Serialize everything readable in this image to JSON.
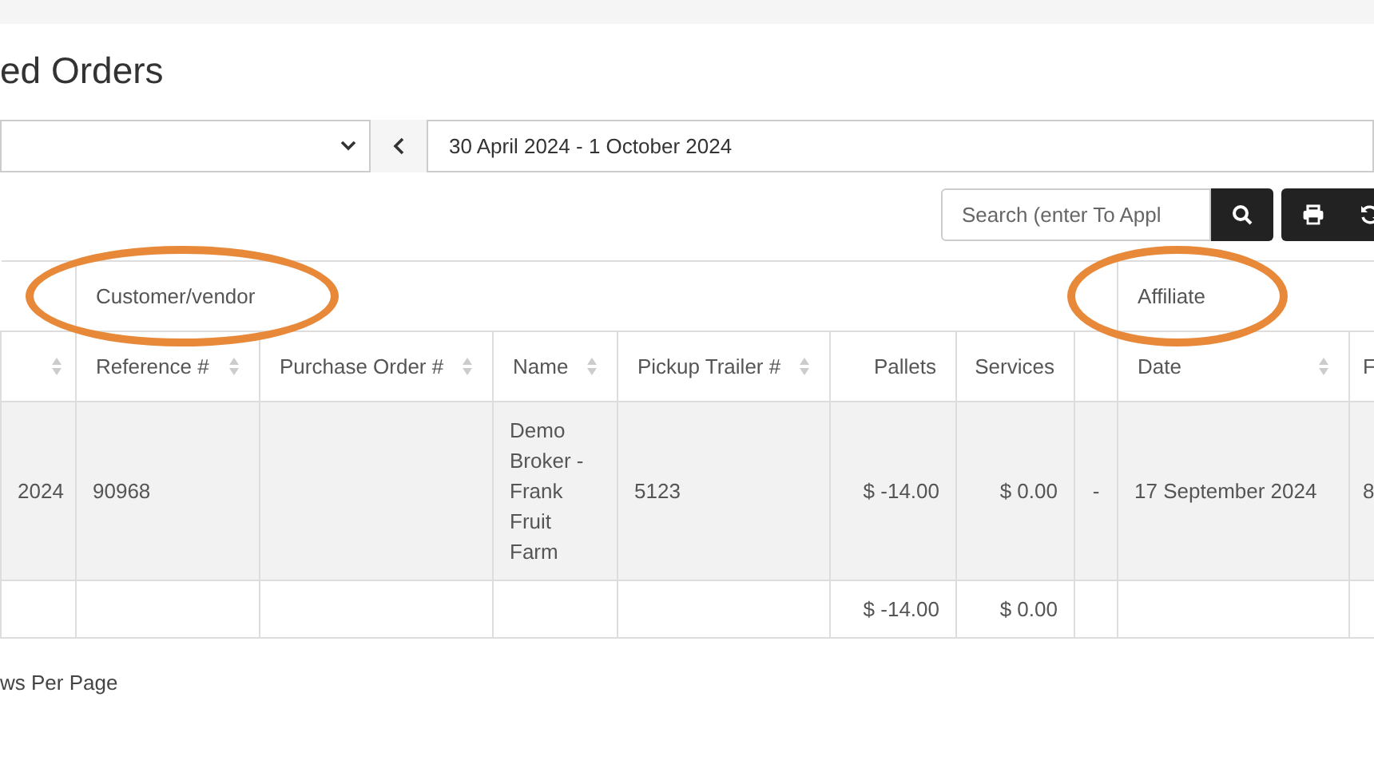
{
  "title": "ed Orders",
  "date_range": "30 April 2024 - 1 October 2024",
  "search": {
    "placeholder": "Search (enter To Appl"
  },
  "table": {
    "column_groups": [
      {
        "label": "Customer/vendor",
        "circled": true
      },
      {
        "label": "Affiliate",
        "circled": true
      }
    ],
    "columns": [
      {
        "sortable": true
      },
      {
        "label": "Reference #",
        "sortable": true
      },
      {
        "label": "Purchase Order #",
        "sortable": true
      },
      {
        "label": "Name",
        "sortable": true
      },
      {
        "label": "Pickup Trailer #",
        "sortable": true
      },
      {
        "label": "Pallets",
        "sortable": false
      },
      {
        "label": "Services",
        "sortable": false
      },
      {},
      {
        "label": "Date",
        "sortable": true
      },
      {
        "label": "F",
        "sortable": false
      }
    ],
    "rows": [
      [
        "2024",
        "90968",
        null,
        "Demo Broker - Frank Fruit Farm",
        "5123",
        "$ -14.00",
        "$ 0.00",
        "-",
        "17 September 2024",
        "8"
      ]
    ],
    "totals": {
      "pallets": "$ -14.00",
      "services": "$ 0.00"
    }
  },
  "footer": "ws Per Page"
}
